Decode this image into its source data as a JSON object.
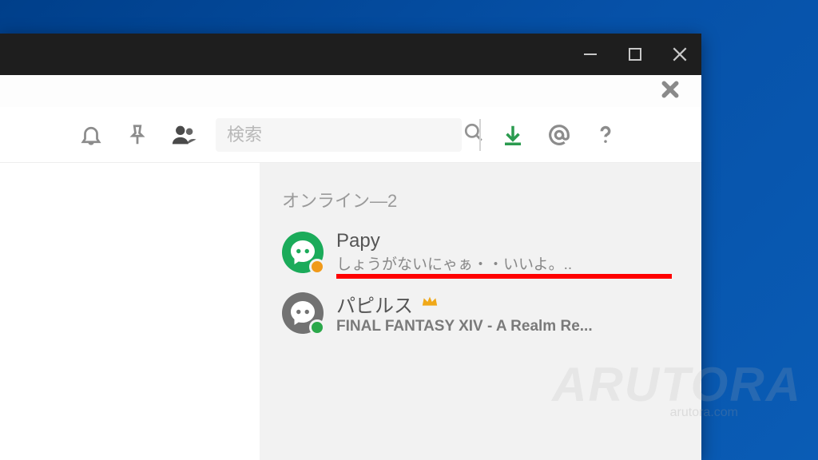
{
  "toolbar": {
    "search_placeholder": "検索"
  },
  "members": {
    "section_label": "オンライン—2",
    "items": [
      {
        "name": "Papy",
        "status": "しょうがないにゃぁ・・いいよ。..",
        "avatar_color": "green",
        "presence": "idle",
        "owner": false,
        "underline": true,
        "bold_status": false
      },
      {
        "name": "パピルス",
        "status": "FINAL FANTASY XIV - A Realm Re...",
        "avatar_color": "grey",
        "presence": "online",
        "owner": true,
        "underline": false,
        "bold_status": true
      }
    ]
  },
  "watermark": {
    "main": "ARUTORA",
    "sub": "arutora.com"
  }
}
